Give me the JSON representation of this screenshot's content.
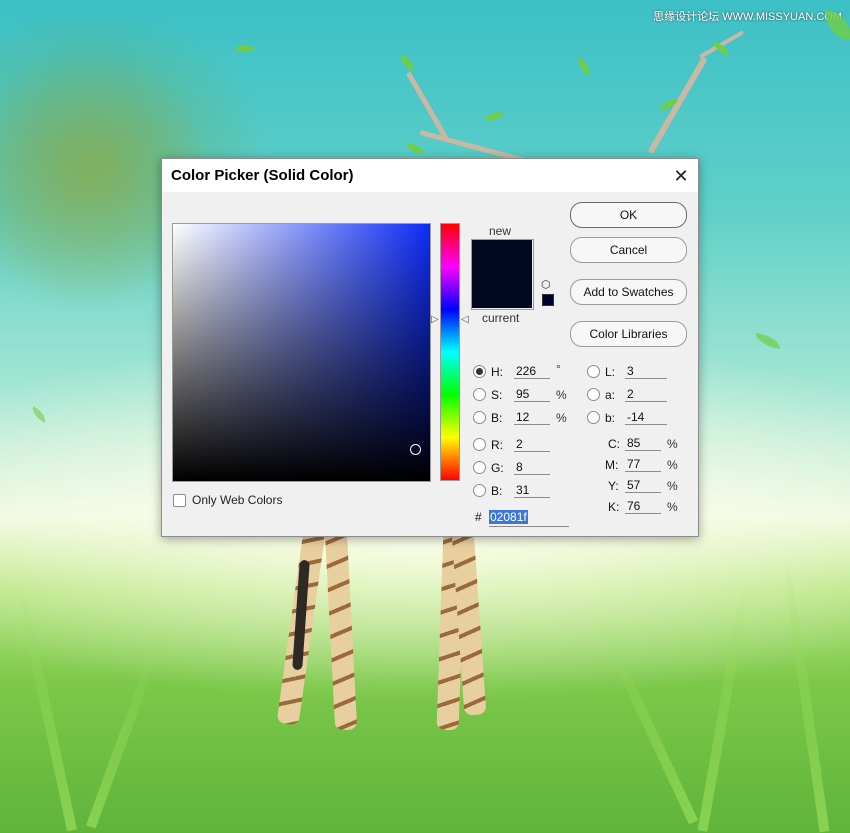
{
  "watermark": "思缘设计论坛 WWW.MISSYUAN.COM",
  "dialog": {
    "title": "Color Picker (Solid Color)",
    "close_glyph": "✕"
  },
  "preview": {
    "new_label": "new",
    "current_label": "current",
    "new_color": "#02081f",
    "current_color": "#02081f"
  },
  "buttons": {
    "ok": "OK",
    "cancel": "Cancel",
    "add_swatches": "Add to Swatches",
    "color_libraries": "Color Libraries"
  },
  "hsb": {
    "h": {
      "label": "H:",
      "value": "226",
      "unit": "°",
      "checked": true
    },
    "s": {
      "label": "S:",
      "value": "95",
      "unit": "%"
    },
    "b": {
      "label": "B:",
      "value": "12",
      "unit": "%"
    }
  },
  "rgb": {
    "r": {
      "label": "R:",
      "value": "2"
    },
    "g": {
      "label": "G:",
      "value": "8"
    },
    "b": {
      "label": "B:",
      "value": "31"
    }
  },
  "lab": {
    "l": {
      "label": "L:",
      "value": "3"
    },
    "a": {
      "label": "a:",
      "value": "2"
    },
    "b": {
      "label": "b:",
      "value": "-14"
    }
  },
  "cmyk": {
    "c": {
      "label": "C:",
      "value": "85",
      "unit": "%"
    },
    "m": {
      "label": "M:",
      "value": "77",
      "unit": "%"
    },
    "y": {
      "label": "Y:",
      "value": "57",
      "unit": "%"
    },
    "k": {
      "label": "K:",
      "value": "76",
      "unit": "%"
    }
  },
  "hex": {
    "label": "#",
    "value": "02081f"
  },
  "only_web_colors": {
    "label": "Only Web Colors",
    "checked": false
  },
  "accent_colors": {
    "field_base": "#0d2cf5",
    "selection": "#3c78d8"
  }
}
